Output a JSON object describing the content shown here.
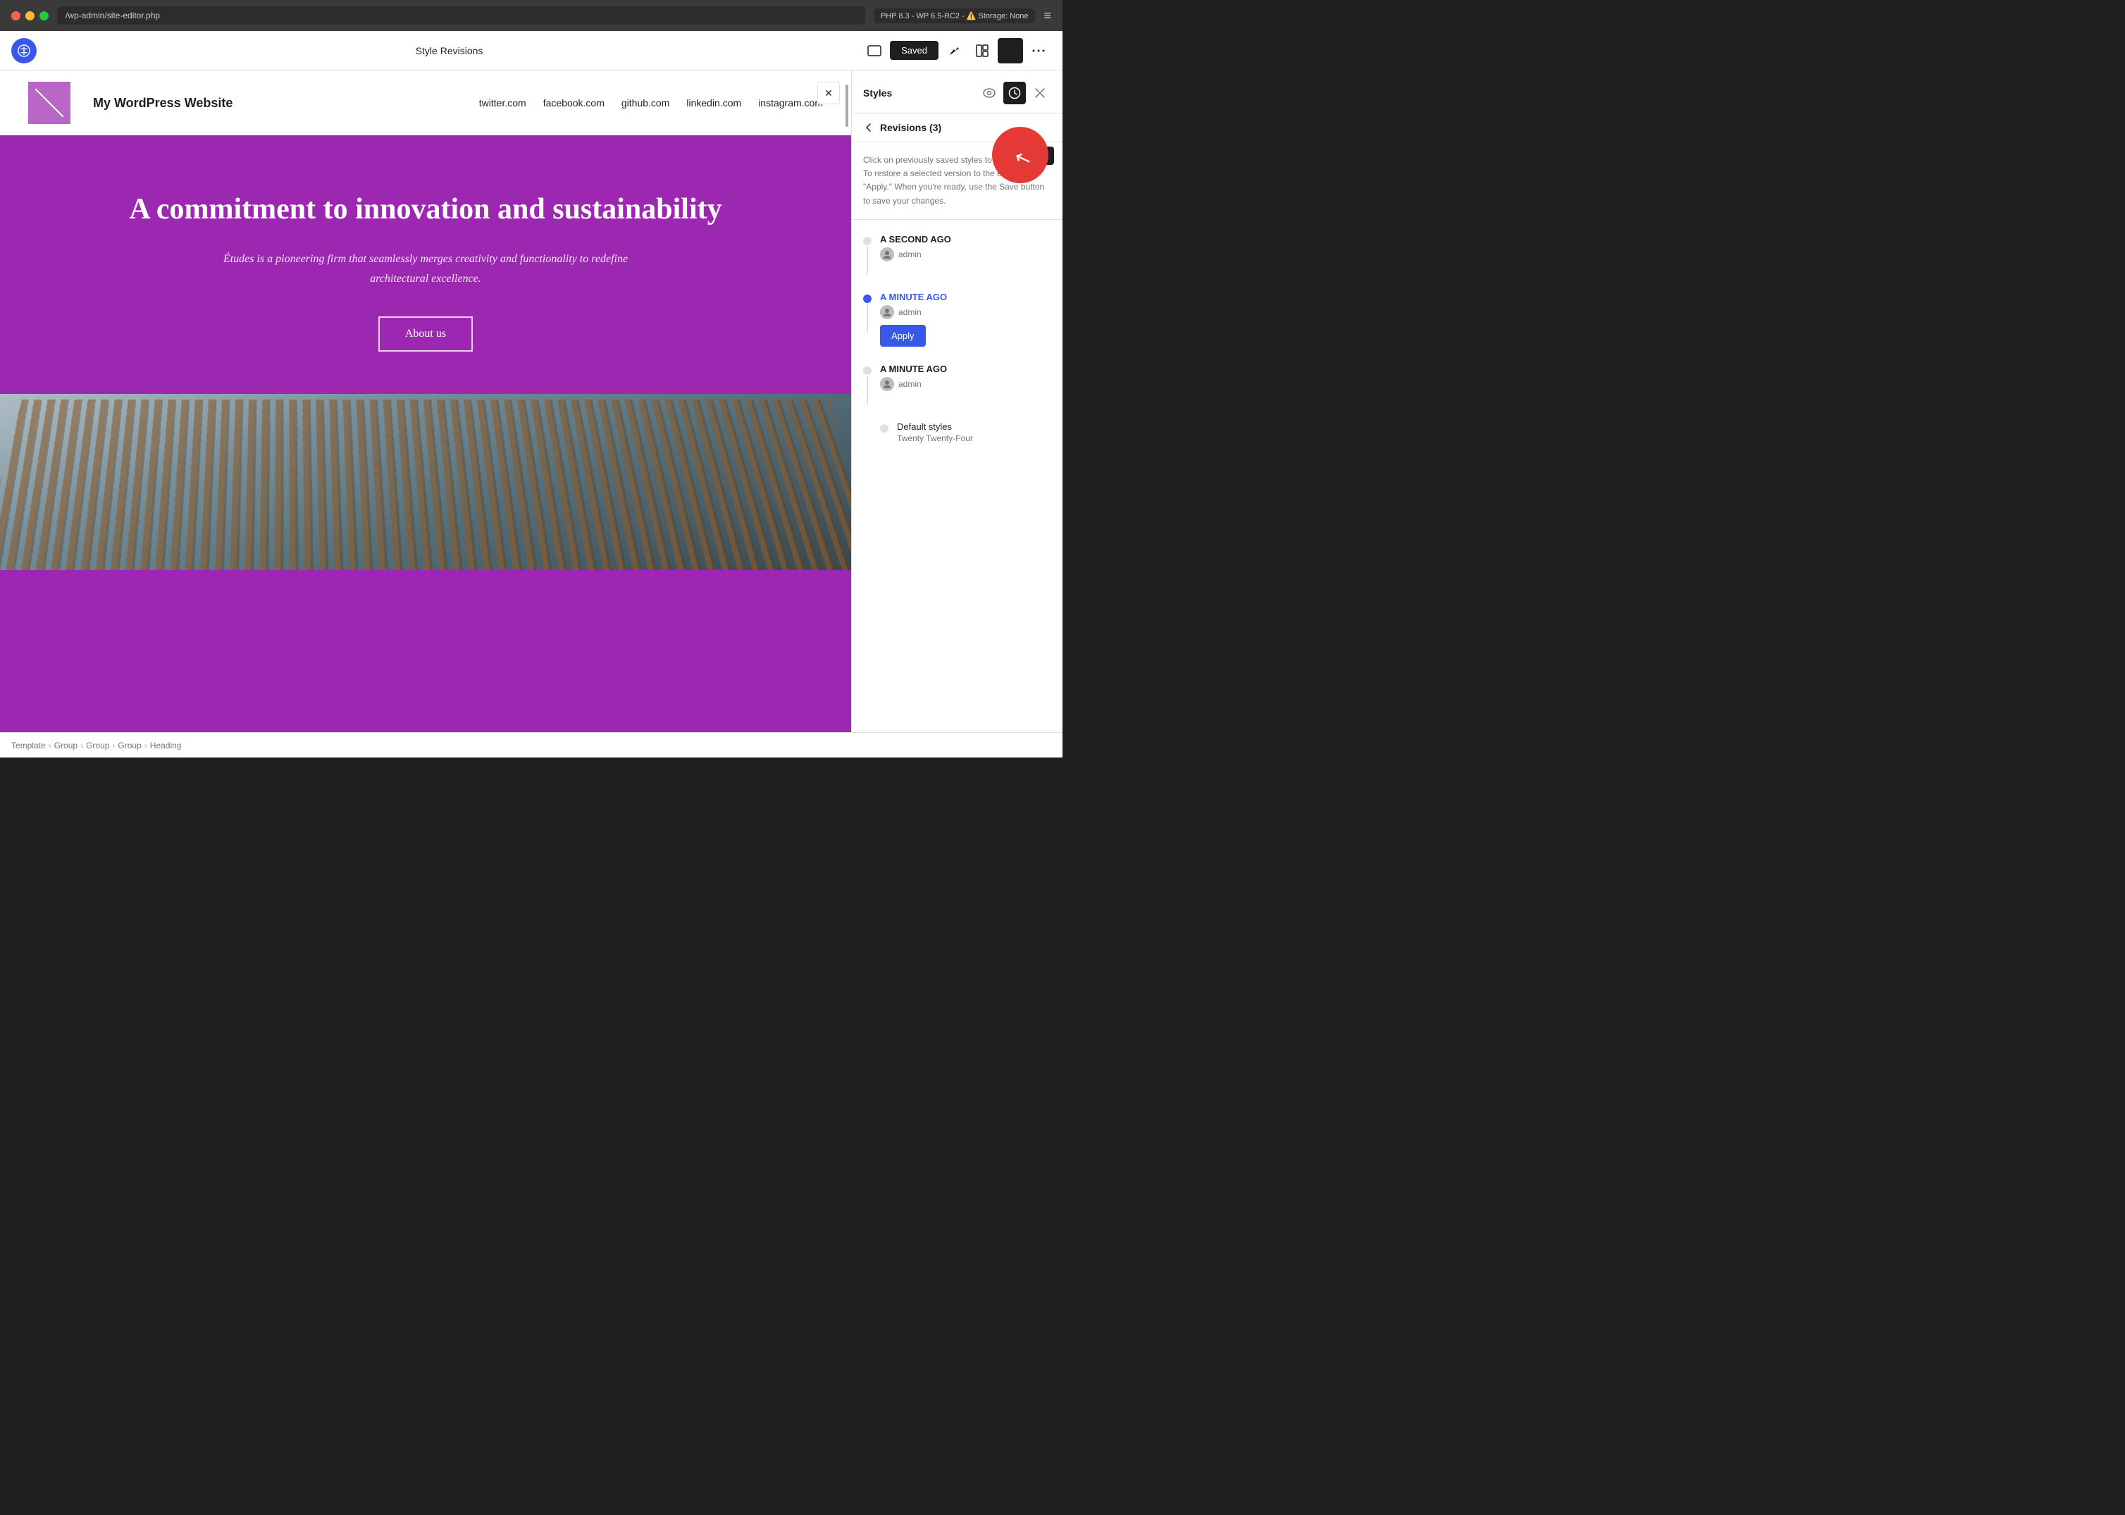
{
  "browser": {
    "address": "/wp-admin/site-editor.php",
    "php_badge": "PHP 8.3 - WP 6.5-RC2 - ⚠️ Storage: None",
    "menu_icon": "≡"
  },
  "toolbar": {
    "title": "Style Revisions",
    "saved_label": "Saved",
    "wp_logo": "W",
    "icons": {
      "view": "🖥",
      "brush": "✏",
      "layout": "⊞",
      "styles": "◑",
      "more": "⋯"
    }
  },
  "canvas": {
    "close_label": "✕",
    "site": {
      "logo_alt": "Site logo placeholder",
      "name": "My WordPress Website",
      "nav": [
        "twitter.com",
        "facebook.com",
        "github.com",
        "linkedin.com",
        "instagram.com"
      ],
      "hero_title": "A commitment to innovation and sustainability",
      "hero_subtitle": "Études is a pioneering firm that seamlessly merges creativity and functionality to redefine architectural excellence.",
      "hero_cta": "About us"
    }
  },
  "sidebar": {
    "header_title": "Styles",
    "icons": {
      "eye": "👁",
      "revisions": "🕐",
      "close": "✕"
    },
    "tooltip": "Revisions",
    "revisions": {
      "title": "Revisions (3)",
      "description": "Click on previously saved styles to preview them. To restore a selected version to the editor, hit \"Apply.\" When you're ready, use the Save button to save your changes.",
      "items": [
        {
          "time": "A SECOND AGO",
          "author": "admin",
          "active": false,
          "show_apply": false
        },
        {
          "time": "A MINUTE AGO",
          "author": "admin",
          "active": true,
          "show_apply": true,
          "apply_label": "Apply"
        },
        {
          "time": "A MINUTE AGO",
          "author": "admin",
          "active": false,
          "show_apply": false
        }
      ],
      "default_styles": {
        "label": "Default styles",
        "theme": "Twenty Twenty-Four"
      }
    }
  },
  "breadcrumb": {
    "items": [
      "Template",
      "Group",
      "Group",
      "Group",
      "Heading"
    ]
  }
}
